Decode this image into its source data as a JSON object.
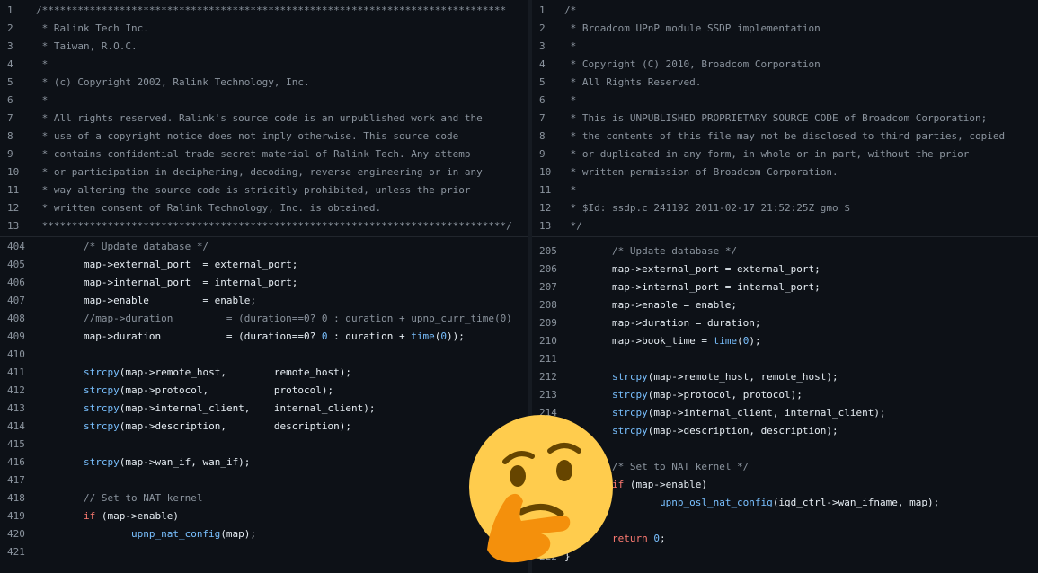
{
  "left": {
    "header": [
      {
        "ln": "1",
        "text": "/******************************************************************************"
      },
      {
        "ln": "2",
        "text": " * Ralink Tech Inc."
      },
      {
        "ln": "3",
        "text": " * Taiwan, R.O.C."
      },
      {
        "ln": "4",
        "text": " *"
      },
      {
        "ln": "5",
        "text": " * (c) Copyright 2002, Ralink Technology, Inc."
      },
      {
        "ln": "6",
        "text": " *"
      },
      {
        "ln": "7",
        "text": " * All rights reserved. Ralink's source code is an unpublished work and the"
      },
      {
        "ln": "8",
        "text": " * use of a copyright notice does not imply otherwise. This source code"
      },
      {
        "ln": "9",
        "text": " * contains confidential trade secret material of Ralink Tech. Any attemp"
      },
      {
        "ln": "10",
        "text": " * or participation in deciphering, decoding, reverse engineering or in any"
      },
      {
        "ln": "11",
        "text": " * way altering the source code is stricitly prohibited, unless the prior"
      },
      {
        "ln": "12",
        "text": " * written consent of Ralink Technology, Inc. is obtained."
      },
      {
        "ln": "13",
        "text": " ******************************************************************************/"
      }
    ],
    "body": [
      {
        "ln": "404",
        "parts": [
          {
            "t": "        "
          },
          {
            "t": "/* Update database */",
            "c": "cm"
          }
        ]
      },
      {
        "ln": "405",
        "parts": [
          {
            "t": "        map->external_port  = external_port;"
          }
        ]
      },
      {
        "ln": "406",
        "parts": [
          {
            "t": "        map->internal_port  = internal_port;"
          }
        ]
      },
      {
        "ln": "407",
        "parts": [
          {
            "t": "        map->enable         = enable;"
          }
        ]
      },
      {
        "ln": "408",
        "parts": [
          {
            "t": "        "
          },
          {
            "t": "//map->duration         = (duration==0? 0 : duration + upnp_curr_time(0)",
            "c": "cm"
          }
        ]
      },
      {
        "ln": "409",
        "parts": [
          {
            "t": "        map->duration           = (duration==0? "
          },
          {
            "t": "0",
            "c": "num"
          },
          {
            "t": " : duration + "
          },
          {
            "t": "time",
            "c": "fn"
          },
          {
            "t": "("
          },
          {
            "t": "0",
            "c": "num"
          },
          {
            "t": "));"
          }
        ]
      },
      {
        "ln": "410",
        "parts": [
          {
            "t": ""
          }
        ]
      },
      {
        "ln": "411",
        "parts": [
          {
            "t": "        "
          },
          {
            "t": "strcpy",
            "c": "fn"
          },
          {
            "t": "(map->remote_host,        remote_host);"
          }
        ]
      },
      {
        "ln": "412",
        "parts": [
          {
            "t": "        "
          },
          {
            "t": "strcpy",
            "c": "fn"
          },
          {
            "t": "(map->protocol,           protocol);"
          }
        ]
      },
      {
        "ln": "413",
        "parts": [
          {
            "t": "        "
          },
          {
            "t": "strcpy",
            "c": "fn"
          },
          {
            "t": "(map->internal_client,    internal_client);"
          }
        ]
      },
      {
        "ln": "414",
        "parts": [
          {
            "t": "        "
          },
          {
            "t": "strcpy",
            "c": "fn"
          },
          {
            "t": "(map->description,        description);"
          }
        ]
      },
      {
        "ln": "415",
        "parts": [
          {
            "t": ""
          }
        ]
      },
      {
        "ln": "416",
        "parts": [
          {
            "t": "        "
          },
          {
            "t": "strcpy",
            "c": "fn"
          },
          {
            "t": "(map->wan_if, wan_if);"
          }
        ]
      },
      {
        "ln": "417",
        "parts": [
          {
            "t": ""
          }
        ]
      },
      {
        "ln": "418",
        "parts": [
          {
            "t": "        "
          },
          {
            "t": "// Set to NAT kernel",
            "c": "cm"
          }
        ]
      },
      {
        "ln": "419",
        "parts": [
          {
            "t": "        "
          },
          {
            "t": "if",
            "c": "kw"
          },
          {
            "t": " (map->enable)"
          }
        ]
      },
      {
        "ln": "420",
        "parts": [
          {
            "t": "                "
          },
          {
            "t": "upnp_nat_config",
            "c": "fn"
          },
          {
            "t": "(map);"
          }
        ]
      },
      {
        "ln": "421",
        "parts": [
          {
            "t": ""
          }
        ]
      }
    ]
  },
  "right": {
    "header": [
      {
        "ln": "1",
        "text": "/*"
      },
      {
        "ln": "2",
        "text": " * Broadcom UPnP module SSDP implementation"
      },
      {
        "ln": "3",
        "text": " *"
      },
      {
        "ln": "4",
        "text": " * Copyright (C) 2010, Broadcom Corporation"
      },
      {
        "ln": "5",
        "text": " * All Rights Reserved."
      },
      {
        "ln": "6",
        "text": " *"
      },
      {
        "ln": "7",
        "text": " * This is UNPUBLISHED PROPRIETARY SOURCE CODE of Broadcom Corporation;"
      },
      {
        "ln": "8",
        "text": " * the contents of this file may not be disclosed to third parties, copied"
      },
      {
        "ln": "9",
        "text": " * or duplicated in any form, in whole or in part, without the prior"
      },
      {
        "ln": "10",
        "text": " * written permission of Broadcom Corporation."
      },
      {
        "ln": "11",
        "text": " *"
      },
      {
        "ln": "12",
        "text": " * $Id: ssdp.c 241192 2011-02-17 21:52:25Z gmo $"
      },
      {
        "ln": "13",
        "text": " */"
      }
    ],
    "body": [
      {
        "ln": "205",
        "parts": [
          {
            "t": "        "
          },
          {
            "t": "/* Update database */",
            "c": "cm"
          }
        ]
      },
      {
        "ln": "206",
        "parts": [
          {
            "t": "        map->external_port = external_port;"
          }
        ]
      },
      {
        "ln": "207",
        "parts": [
          {
            "t": "        map->internal_port = internal_port;"
          }
        ]
      },
      {
        "ln": "208",
        "parts": [
          {
            "t": "        map->enable = enable;"
          }
        ]
      },
      {
        "ln": "209",
        "parts": [
          {
            "t": "        map->duration = duration;"
          }
        ]
      },
      {
        "ln": "210",
        "parts": [
          {
            "t": "        map->book_time = "
          },
          {
            "t": "time",
            "c": "fn"
          },
          {
            "t": "("
          },
          {
            "t": "0",
            "c": "num"
          },
          {
            "t": ");"
          }
        ]
      },
      {
        "ln": "211",
        "parts": [
          {
            "t": ""
          }
        ]
      },
      {
        "ln": "212",
        "parts": [
          {
            "t": "        "
          },
          {
            "t": "strcpy",
            "c": "fn"
          },
          {
            "t": "(map->remote_host, remote_host);"
          }
        ]
      },
      {
        "ln": "213",
        "parts": [
          {
            "t": "        "
          },
          {
            "t": "strcpy",
            "c": "fn"
          },
          {
            "t": "(map->protocol, protocol);"
          }
        ]
      },
      {
        "ln": "214",
        "parts": [
          {
            "t": "        "
          },
          {
            "t": "strcpy",
            "c": "fn"
          },
          {
            "t": "(map->internal_client, internal_client);"
          }
        ]
      },
      {
        "ln": "215",
        "parts": [
          {
            "t": "        "
          },
          {
            "t": "strcpy",
            "c": "fn"
          },
          {
            "t": "(map->description, description);"
          }
        ]
      },
      {
        "ln": "216",
        "parts": [
          {
            "t": ""
          }
        ]
      },
      {
        "ln": "217",
        "parts": [
          {
            "t": "        "
          },
          {
            "t": "/* Set to NAT kernel */",
            "c": "cm"
          }
        ]
      },
      {
        "ln": "218",
        "parts": [
          {
            "t": "        "
          },
          {
            "t": "if",
            "c": "kw"
          },
          {
            "t": " (map->enable)"
          }
        ]
      },
      {
        "ln": "219",
        "parts": [
          {
            "t": "                "
          },
          {
            "t": "upnp_osl_nat_config",
            "c": "fn"
          },
          {
            "t": "(igd_ctrl->wan_ifname, map);"
          }
        ]
      },
      {
        "ln": "220",
        "parts": [
          {
            "t": ""
          }
        ]
      },
      {
        "ln": "221",
        "parts": [
          {
            "t": "        "
          },
          {
            "t": "return",
            "c": "kw"
          },
          {
            "t": " "
          },
          {
            "t": "0",
            "c": "num"
          },
          {
            "t": ";"
          }
        ]
      },
      {
        "ln": "222",
        "parts": [
          {
            "t": "}"
          }
        ]
      }
    ]
  },
  "overlay": {
    "emoji_icon": "thinking-face-emoji"
  },
  "colors": {
    "background": "#0d1117",
    "comment": "#8b949e",
    "function": "#79c0ff",
    "keyword": "#ff7b72",
    "text": "#e6edf3",
    "line_number": "#8b949e"
  }
}
